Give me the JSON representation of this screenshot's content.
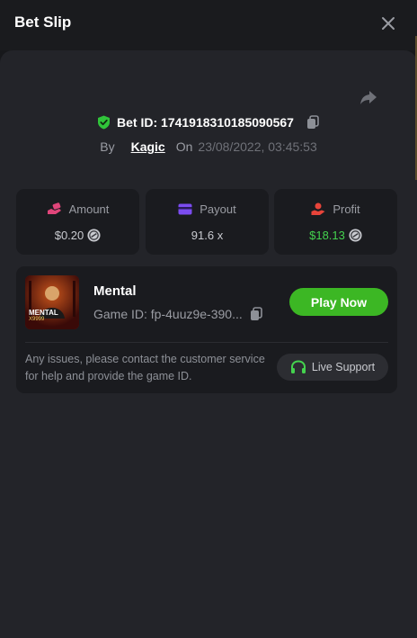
{
  "header": {
    "title": "Bet Slip"
  },
  "bet": {
    "id_text": "Bet ID: 1741918310185090567",
    "by_label": "By",
    "username": "Kagic",
    "on_label": "On",
    "datetime": "23/08/2022, 03:45:53"
  },
  "stats": {
    "amount": {
      "label": "Amount",
      "value": "$0.20",
      "icon": "money-hand-icon"
    },
    "payout": {
      "label": "Payout",
      "value": "91.6 x",
      "icon": "card-icon"
    },
    "profit": {
      "label": "Profit",
      "value": "$18.13",
      "icon": "hand-coin-icon"
    }
  },
  "game": {
    "name": "Mental",
    "id_text": "Game ID: fp-4uuz9e-390...",
    "thumb_title": "MENTAL",
    "thumb_sub": "X9999",
    "play_label": "Play Now",
    "help_text": "Any issues, please contact the customer service for help and provide the game ID.",
    "support_label": "Live Support"
  },
  "colors": {
    "accent_green": "#3cb724",
    "profit_green": "#44d24e",
    "amount_icon": "#e0457a",
    "payout_icon": "#7b4cf0",
    "profit_icon": "#e8443a"
  }
}
